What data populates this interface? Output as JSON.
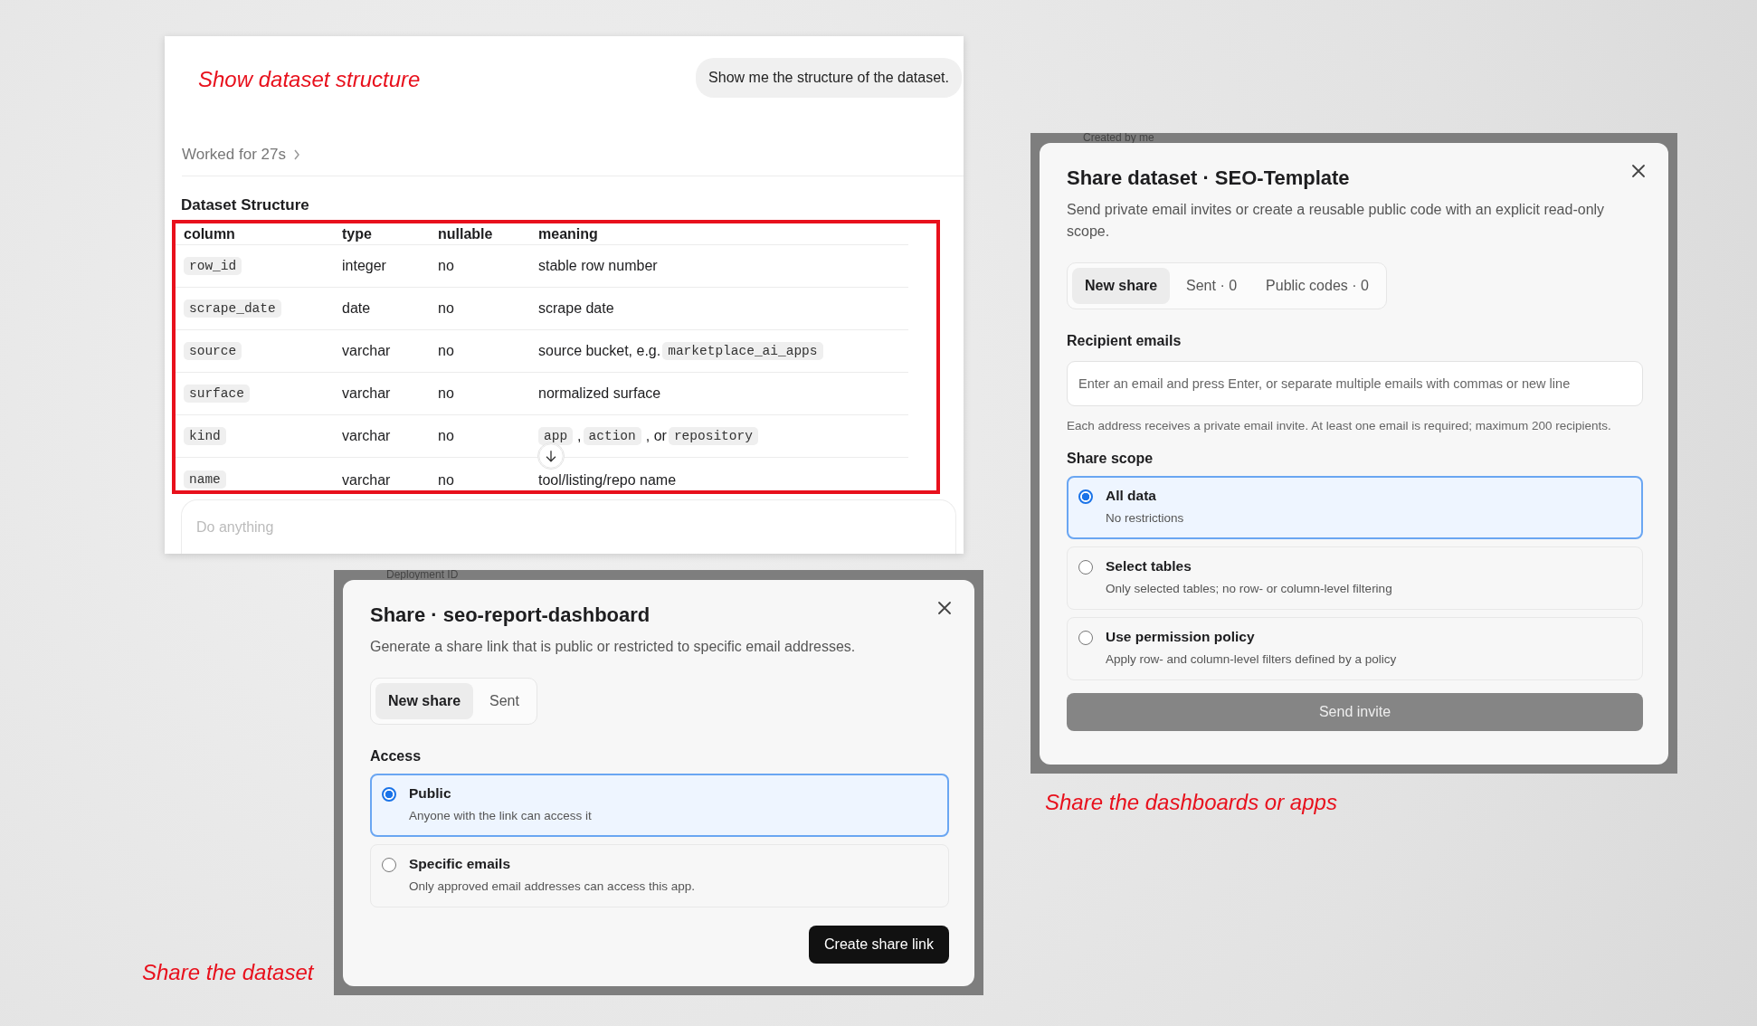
{
  "chat_panel": {
    "caption": "Show dataset structure",
    "user_message": "Show me the structure of the dataset.",
    "worked_for": "Worked for 27s",
    "heading": "Dataset Structure",
    "table": {
      "columns": [
        "column",
        "type",
        "nullable",
        "meaning"
      ],
      "rows": [
        {
          "column": "row_id",
          "type": "integer",
          "nullable": "no",
          "meaning": [
            {
              "kind": "text",
              "text": "stable row number"
            }
          ]
        },
        {
          "column": "scrape_date",
          "type": "date",
          "nullable": "no",
          "meaning": [
            {
              "kind": "text",
              "text": "scrape date"
            }
          ]
        },
        {
          "column": "source",
          "type": "varchar",
          "nullable": "no",
          "meaning": [
            {
              "kind": "text",
              "text": "source bucket, e.g."
            },
            {
              "kind": "code",
              "text": "marketplace_ai_apps"
            }
          ]
        },
        {
          "column": "surface",
          "type": "varchar",
          "nullable": "no",
          "meaning": [
            {
              "kind": "text",
              "text": "normalized surface"
            }
          ]
        },
        {
          "column": "kind",
          "type": "varchar",
          "nullable": "no",
          "meaning": [
            {
              "kind": "code",
              "text": "app"
            },
            {
              "kind": "text",
              "text": ","
            },
            {
              "kind": "code",
              "text": "action"
            },
            {
              "kind": "text",
              "text": ", or"
            },
            {
              "kind": "code",
              "text": "repository"
            }
          ]
        },
        {
          "column": "name",
          "type": "varchar",
          "nullable": "no",
          "meaning": [
            {
              "kind": "text",
              "text": "tool/listing/repo name"
            }
          ]
        }
      ]
    },
    "composer": {
      "placeholder": "Do anything"
    }
  },
  "app_share_dialog": {
    "backdrop_text": "Deployment ID",
    "title": "Share · seo-report-dashboard",
    "description": "Generate a share link that is public or restricted to specific email addresses.",
    "tabs": [
      {
        "label": "New share",
        "selected": true
      },
      {
        "label": "Sent",
        "selected": false
      }
    ],
    "section_label": "Access",
    "options": [
      {
        "title": "Public",
        "description": "Anyone with the link can access it",
        "selected": true
      },
      {
        "title": "Specific emails",
        "description": "Only approved email addresses can access this app.",
        "selected": false
      }
    ],
    "button": {
      "label": "Create share link",
      "disabled": false
    },
    "caption": "Share the dataset"
  },
  "dataset_share_dialog": {
    "backdrop_text": "Created by me",
    "title": "Share dataset · SEO-Template",
    "description": "Send private email invites or create a reusable public code with an explicit read-only scope.",
    "tabs": [
      {
        "label": "New share",
        "selected": true
      },
      {
        "label": "Sent · 0",
        "selected": false
      },
      {
        "label": "Public codes · 0",
        "selected": false
      }
    ],
    "recipients": {
      "label": "Recipient emails",
      "placeholder": "Enter an email and press Enter, or separate multiple emails with commas or new line",
      "help": "Each address receives a private email invite. At least one email is required; maximum 200 recipients."
    },
    "section_label": "Share scope",
    "options": [
      {
        "title": "All data",
        "description": "No restrictions",
        "selected": true
      },
      {
        "title": "Select tables",
        "description": "Only selected tables; no row- or column-level filtering",
        "selected": false
      },
      {
        "title": "Use permission policy",
        "description": "Apply row- and column-level filters defined by a policy",
        "selected": false
      }
    ],
    "button": {
      "label": "Send invite",
      "disabled": true
    },
    "caption": "Share the dashboards or apps"
  }
}
